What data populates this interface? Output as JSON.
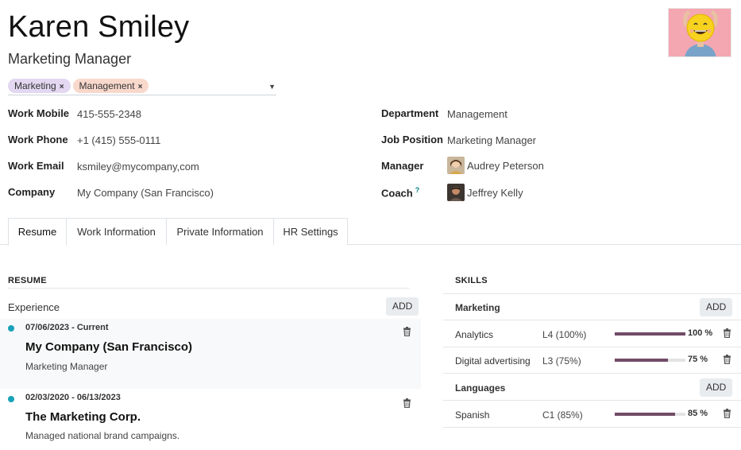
{
  "employee": {
    "name": "Karen Smiley",
    "job_title": "Marketing Manager",
    "tags": [
      {
        "label": "Marketing",
        "color": "#e3d7f1"
      },
      {
        "label": "Management",
        "color": "#f9d8cc"
      }
    ]
  },
  "fields": {
    "work_mobile": {
      "label": "Work Mobile",
      "value": "415-555-2348"
    },
    "work_phone": {
      "label": "Work Phone",
      "value": "+1 (415) 555-0111"
    },
    "work_email": {
      "label": "Work Email",
      "value": "ksmiley@mycompany,com"
    },
    "company": {
      "label": "Company",
      "value": "My Company (San Francisco)"
    },
    "department": {
      "label": "Department",
      "value": "Management"
    },
    "job_position": {
      "label": "Job Position",
      "value": "Marketing Manager"
    },
    "manager": {
      "label": "Manager",
      "value": "Audrey Peterson"
    },
    "coach": {
      "label": "Coach",
      "value": "Jeffrey Kelly",
      "help": "?"
    }
  },
  "tabs": [
    "Resume",
    "Work Information",
    "Private Information",
    "HR Settings"
  ],
  "resume": {
    "title": "RESUME",
    "subhead": "Experience",
    "add_label": "ADD",
    "entries": [
      {
        "date": "07/06/2023 - Current",
        "company": "My Company (San Francisco)",
        "description": "Marketing Manager"
      },
      {
        "date": "02/03/2020 - 06/13/2023",
        "company": "The Marketing Corp.",
        "description": "Managed national brand campaigns."
      }
    ]
  },
  "skills": {
    "title": "SKILLS",
    "add_label": "ADD",
    "groups": [
      {
        "type": "Marketing",
        "items": [
          {
            "name": "Analytics",
            "level": "L4 (100%)",
            "progress": 100,
            "pct_label": "100 %"
          },
          {
            "name": "Digital advertising",
            "level": "L3 (75%)",
            "progress": 75,
            "pct_label": "75 %"
          }
        ]
      },
      {
        "type": "Languages",
        "items": [
          {
            "name": "Spanish",
            "level": "C1 (85%)",
            "progress": 85,
            "pct_label": "85 %"
          }
        ]
      }
    ]
  },
  "colors": {
    "accent": "#714b67",
    "timeline_dot": "#17a2b8",
    "avatar_bg": "#f4a7b1"
  },
  "icons": {
    "trash": "trash-icon",
    "caret": "caret-down-icon"
  }
}
